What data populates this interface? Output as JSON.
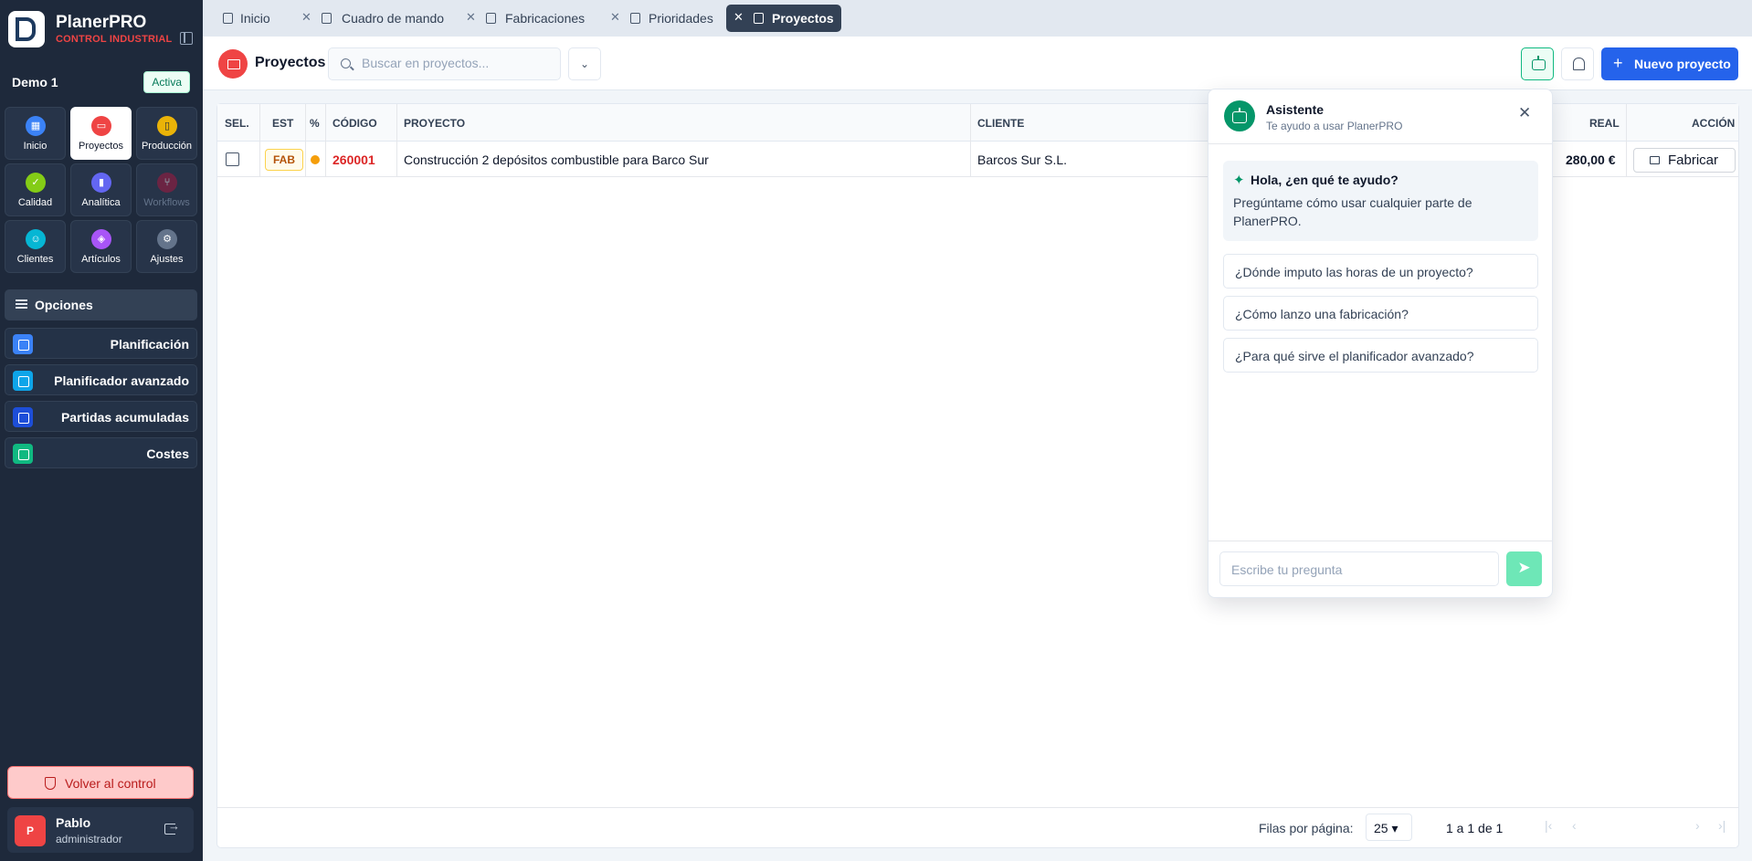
{
  "brand": {
    "title": "PlanerPRO",
    "subtitle": "CONTROL INDUSTRIAL"
  },
  "tenant": {
    "name": "Demo 1",
    "status": "Activa"
  },
  "modules": [
    {
      "label": "Inicio",
      "icon": "grid-icon",
      "color": "#3b82f6"
    },
    {
      "label": "Proyectos",
      "icon": "folder-icon",
      "color": "#ef4444"
    },
    {
      "label": "Producción",
      "icon": "factory-icon",
      "color": "#eab308"
    },
    {
      "label": "Calidad",
      "icon": "quality-icon",
      "color": "#84cc16"
    },
    {
      "label": "Analítica",
      "icon": "bar-chart-icon",
      "color": "#6366f1"
    },
    {
      "label": "Workflows",
      "icon": "workflow-icon",
      "color": "#be123c"
    },
    {
      "label": "Clientes",
      "icon": "users-icon",
      "color": "#06b6d4"
    },
    {
      "label": "Artículos",
      "icon": "box-icon",
      "color": "#a855f7"
    },
    {
      "label": "Ajustes",
      "icon": "gear-icon",
      "color": "#64748b"
    }
  ],
  "options": {
    "header": "Opciones",
    "items": [
      {
        "label": "Planificación",
        "color": "#3b82f6"
      },
      {
        "label": "Planificador avanzado",
        "color": "#0ea5e9"
      },
      {
        "label": "Partidas acumuladas",
        "color": "#1d4ed8"
      },
      {
        "label": "Costes",
        "color": "#10b981"
      }
    ]
  },
  "back_button": "Volver al control",
  "user": {
    "initial": "P",
    "name": "Pablo",
    "role": "administrador"
  },
  "tabs": [
    {
      "label": "Inicio",
      "closable": false,
      "active": false
    },
    {
      "label": "Cuadro de mando",
      "closable": true,
      "active": false
    },
    {
      "label": "Fabricaciones",
      "closable": true,
      "active": false
    },
    {
      "label": "Prioridades",
      "closable": true,
      "active": false
    },
    {
      "label": "Proyectos",
      "closable": true,
      "active": true
    }
  ],
  "page": {
    "title": "Proyectos",
    "search_placeholder": "Buscar en proyectos...",
    "new_button": "Nuevo proyecto"
  },
  "table": {
    "columns": [
      "SEL.",
      "EST",
      "%",
      "CÓDIGO",
      "PROYECTO",
      "CLIENTE",
      "REAL",
      "ACCIÓN"
    ],
    "rows": [
      {
        "status": "FAB",
        "code": "260001",
        "project": "Construcción 2 depósitos combustible para Barco Sur",
        "client": "Barcos Sur S.L.",
        "real": "280,00 €",
        "action": "Fabricar"
      }
    ]
  },
  "pagination": {
    "rows_per_page_label": "Filas por página:",
    "rows_per_page": "25",
    "range": "1 a 1 de 1"
  },
  "assistant": {
    "title": "Asistente",
    "subtitle": "Te ayudo a usar PlanerPRO",
    "intro_heading": "Hola, ¿en qué te ayudo?",
    "intro_body": "Pregúntame cómo usar cualquier parte de PlanerPRO.",
    "suggestions": [
      "¿Dónde imputo las horas de un proyecto?",
      "¿Cómo lanzo una fabricación?",
      "¿Para qué sirve el planificador avanzado?"
    ],
    "input_placeholder": "Escribe tu pregunta"
  },
  "colors": {
    "sidebar": "#1e293b",
    "accent": "#2563eb",
    "brand_red": "#ef4444",
    "assistant_green": "#059669"
  }
}
